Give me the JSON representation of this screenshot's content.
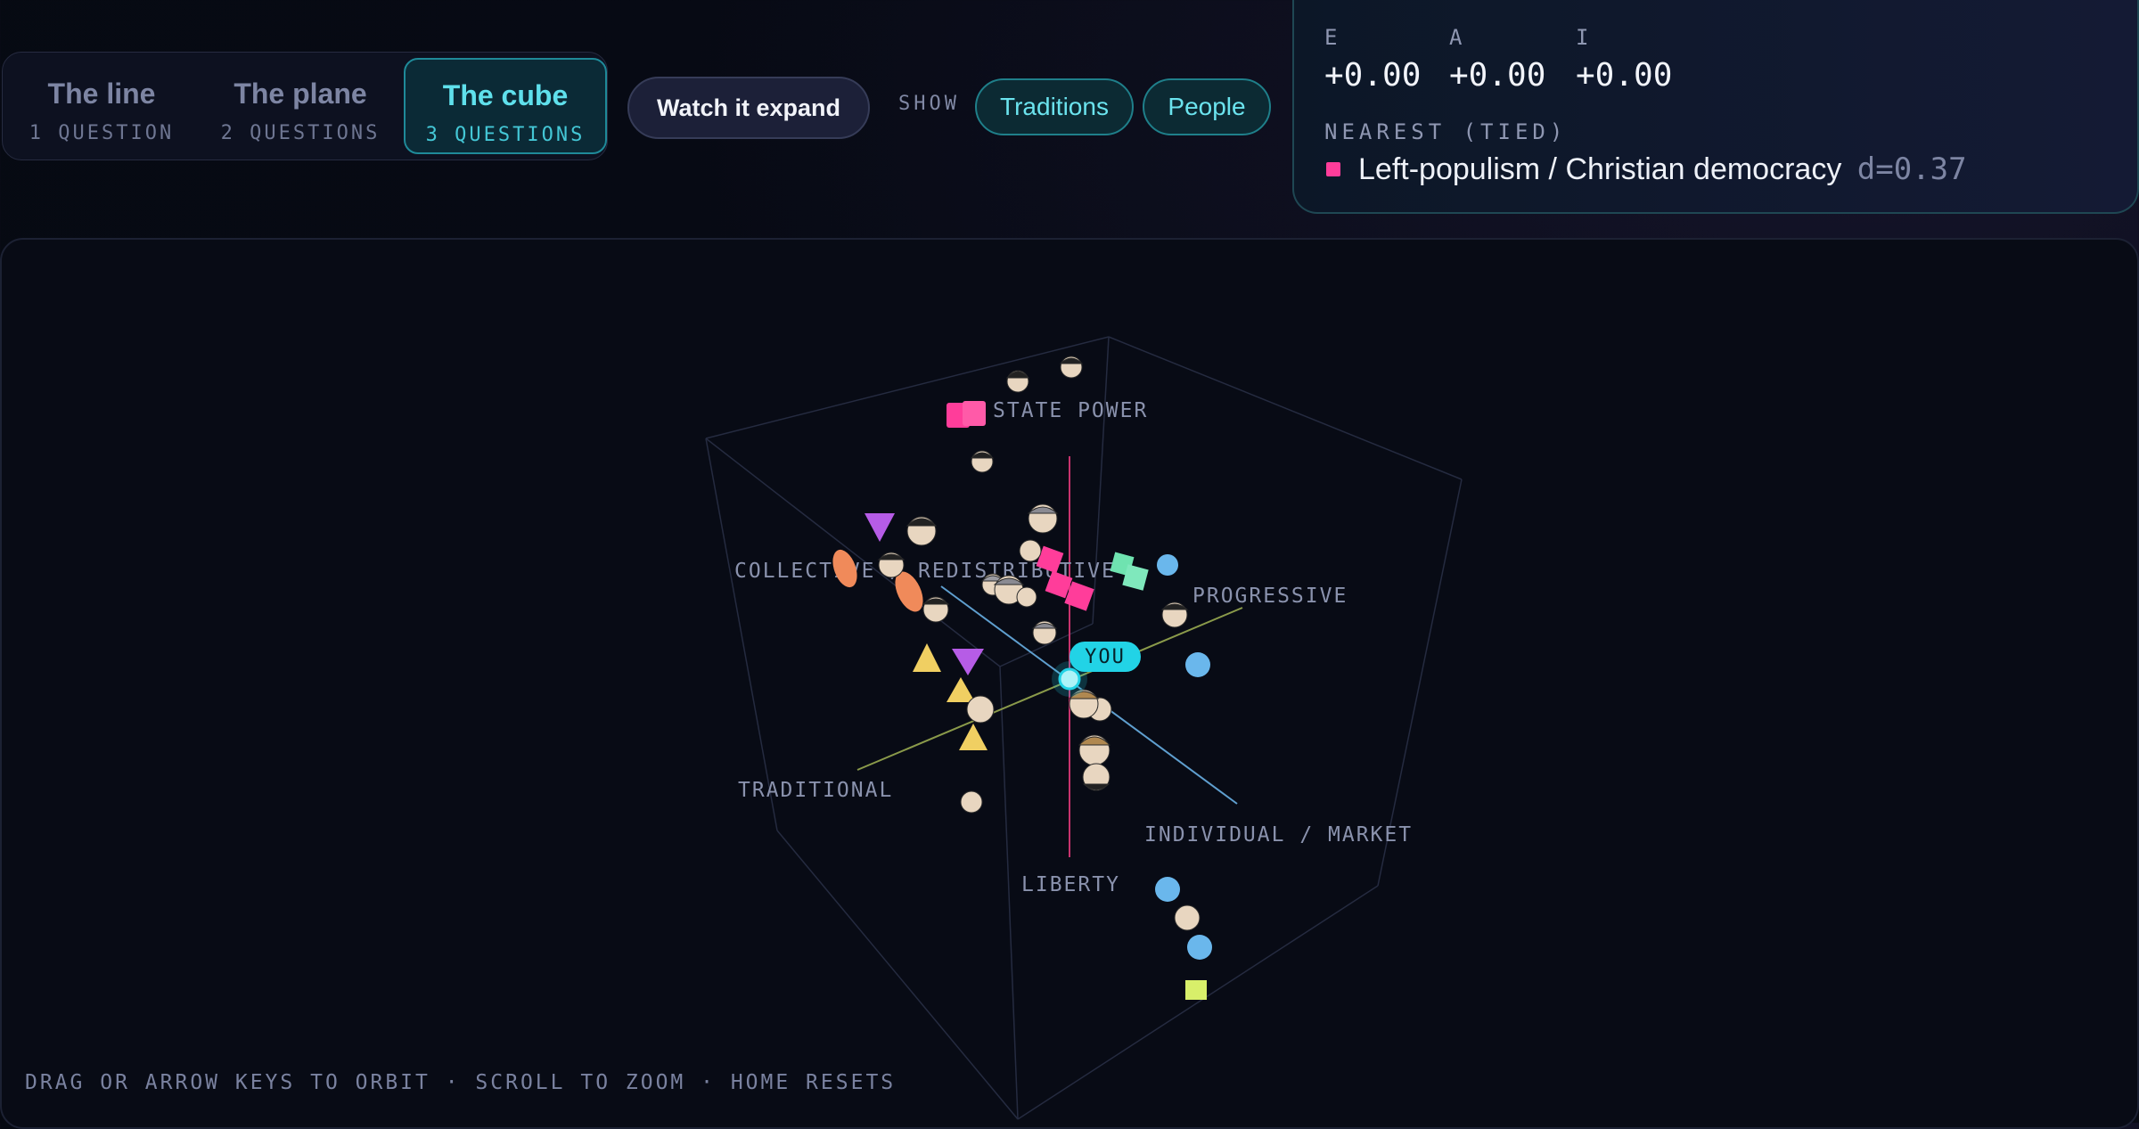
{
  "modes": [
    {
      "title": "The line",
      "subtitle": "1 QUESTION",
      "active": false
    },
    {
      "title": "The plane",
      "subtitle": "2 QUESTIONS",
      "active": false
    },
    {
      "title": "The cube",
      "subtitle": "3 QUESTIONS",
      "active": true
    }
  ],
  "expand_button": "Watch it expand",
  "show": {
    "label": "SHOW",
    "filters": [
      "Traditions",
      "People"
    ]
  },
  "coords": {
    "e": {
      "label": "E",
      "value": "+0.00"
    },
    "a": {
      "label": "A",
      "value": "+0.00"
    },
    "i": {
      "label": "I",
      "value": "+0.00"
    }
  },
  "nearest": {
    "label": "NEAREST (TIED)",
    "name": "Left-populism / Christian democracy",
    "distance": "d=0.37",
    "color": "#ff3d9a"
  },
  "axes": {
    "up": "STATE POWER",
    "down": "LIBERTY",
    "left": "COLLECTIVE / REDISTRIBUTIVE",
    "right": "INDIVIDUAL / MARKET",
    "front": "TRADITIONAL",
    "back": "PROGRESSIVE"
  },
  "you_marker": "YOU",
  "hint": "DRAG OR ARROW KEYS TO ORBIT · SCROLL TO ZOOM · HOME RESETS",
  "colors": {
    "accent": "#22d3e6",
    "traditions_pink": "#ff3d9a",
    "green": "#6fe3b0",
    "blue": "#6ab7ec",
    "orange": "#f08a5a",
    "purple": "#b65ce6",
    "yellow": "#f0cf62",
    "lime": "#d8ef6a"
  }
}
